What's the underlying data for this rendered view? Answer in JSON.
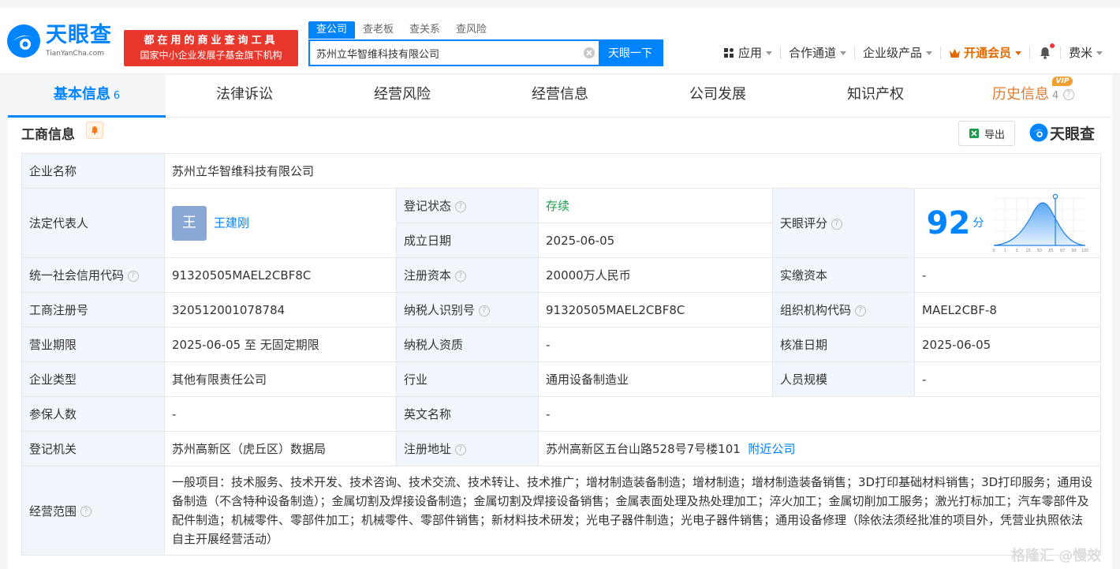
{
  "header": {
    "logo_text": "天眼查",
    "logo_url": "TianYanCha.com",
    "slogan_line1": "都在用的商业查询工具",
    "slogan_line2": "国家中小企业发展子基金旗下机构",
    "search_tabs": [
      "查公司",
      "查老板",
      "查关系",
      "查风险"
    ],
    "search_value": "苏州立华智维科技有限公司",
    "search_button": "天眼一下",
    "nav": {
      "apps": "应用",
      "channel": "合作通道",
      "enterprise": "企业级产品",
      "vip": "开通会员",
      "user": "费米"
    }
  },
  "tabs": [
    {
      "label": "基本信息",
      "count": "6"
    },
    {
      "label": "法律诉讼"
    },
    {
      "label": "经营风险"
    },
    {
      "label": "经营信息"
    },
    {
      "label": "公司发展"
    },
    {
      "label": "知识产权"
    },
    {
      "label": "历史信息",
      "count": "4",
      "badge": "VIP"
    }
  ],
  "section": {
    "title": "工商信息",
    "export": "导出",
    "brand": "天眼查"
  },
  "info": {
    "k_name": "企业名称",
    "v_name": "苏州立华智维科技有限公司",
    "k_legal": "法定代表人",
    "avatar_char": "王",
    "v_legal": "王建刚",
    "k_status": "登记状态",
    "v_status": "存续",
    "k_found": "成立日期",
    "v_found": "2025-06-05",
    "k_score": "天眼评分",
    "v_score": "92",
    "score_unit": "分",
    "k_credit": "统一社会信用代码",
    "v_credit": "91320505MAEL2CBF8C",
    "k_capital": "注册资本",
    "v_capital": "20000万人民币",
    "k_paid": "实缴资本",
    "v_paid": "-",
    "k_regno": "工商注册号",
    "v_regno": "320512001078784",
    "k_taxid": "纳税人识别号",
    "v_taxid": "91320505MAEL2CBF8C",
    "k_org": "组织机构代码",
    "v_org": "MAEL2CBF-8",
    "k_term": "营业期限",
    "v_term": "2025-06-05 至 无固定期限",
    "k_taxq": "纳税人资质",
    "v_taxq": "-",
    "k_approve": "核准日期",
    "v_approve": "2025-06-05",
    "k_type": "企业类型",
    "v_type": "其他有限责任公司",
    "k_industry": "行业",
    "v_industry": "通用设备制造业",
    "k_staff": "人员规模",
    "v_staff": "-",
    "k_insured": "参保人数",
    "v_insured": "-",
    "k_en": "英文名称",
    "v_en": "-",
    "k_authority": "登记机关",
    "v_authority": "苏州高新区（虎丘区）数据局",
    "k_address": "注册地址",
    "v_address": "苏州高新区五台山路528号7号楼101",
    "nearby": "附近公司",
    "k_scope": "经营范围",
    "v_scope": "一般项目：技术服务、技术开发、技术咨询、技术交流、技术转让、技术推广；增材制造装备制造；增材制造；增材制造装备销售；3D打印基础材料销售；3D打印服务；通用设备制造（不含特种设备制造）；金属切割及焊接设备制造；金属切割及焊接设备销售；金属表面处理及热处理加工；淬火加工；金属切削加工服务；激光打标加工；汽车零部件及配件制造；机械零件、零部件加工；机械零件、零部件销售；新材料技术研发；光电子器件制造；光电子器件销售；通用设备修理（除依法须经批准的项目外，凭营业执照依法自主开展经营活动）"
  },
  "score_chart_ticks": [
    "0",
    "1",
    "3",
    "15",
    "50",
    "85",
    "97",
    "99",
    "100"
  ],
  "watermark": "格隆汇 @慢效"
}
